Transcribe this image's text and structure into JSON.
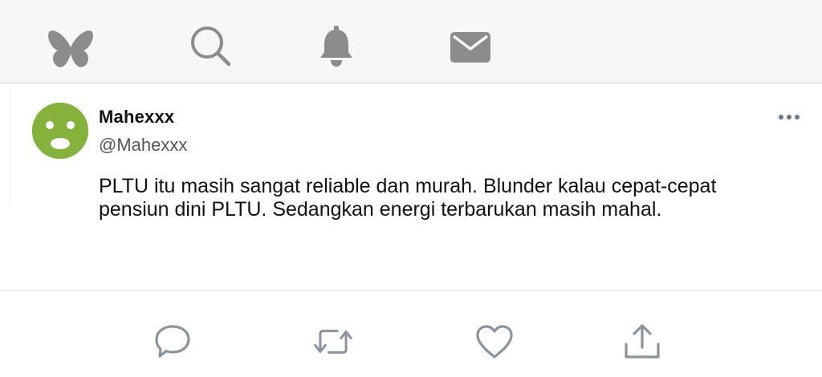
{
  "nav": {
    "items": [
      {
        "icon": "butterfly-icon",
        "label": "home"
      },
      {
        "icon": "search-icon",
        "label": "search"
      },
      {
        "icon": "bell-icon",
        "label": "notifications"
      },
      {
        "icon": "mail-icon",
        "label": "messages"
      }
    ],
    "icon_color": "#888888"
  },
  "post": {
    "display_name": "Mahexxx",
    "handle": "@Mahexxx",
    "avatar_color": "#84b23a",
    "more_icon": "more-dots-icon",
    "text": "PLTU itu masih sangat reliable dan murah. Blunder kalau cepat-cepat pensiun dini PLTU. Sedangkan energi terbarukan masih mahal."
  },
  "actions": {
    "items": [
      {
        "icon": "reply-icon"
      },
      {
        "icon": "repost-icon"
      },
      {
        "icon": "like-icon"
      },
      {
        "icon": "share-icon"
      }
    ],
    "icon_color": "#8a949e"
  }
}
